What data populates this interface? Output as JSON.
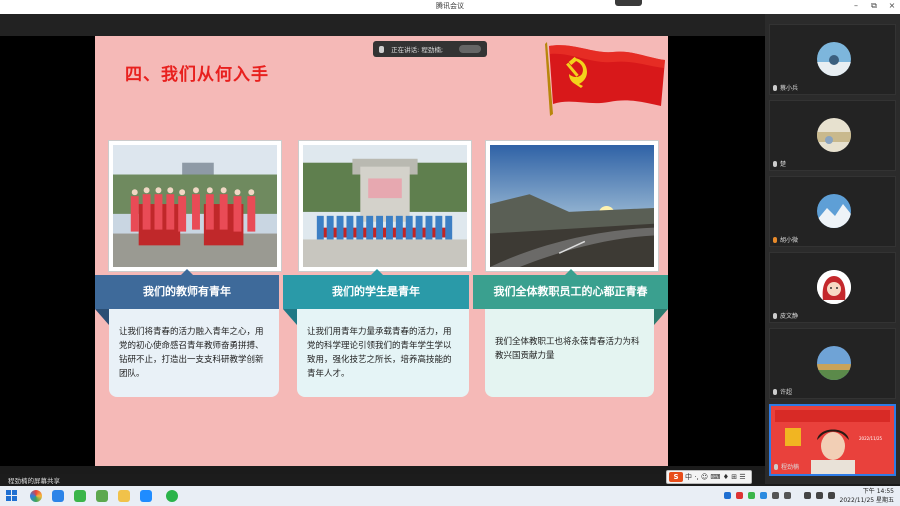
{
  "window": {
    "title": "腾讯会议",
    "minimize_glyph": "–",
    "maximize_glyph": "⧉",
    "close_glyph": "×"
  },
  "speaking": {
    "label": "正在讲话: 程劲楠;"
  },
  "slide": {
    "title": "四、我们从何入手",
    "cards": [
      {
        "heading": "我们的教师有青年",
        "body": "让我们将青春的活力融入青年之心，用党的初心使命感召青年教师奋勇拼搏、钻研不止，打造出一支支科研教学创新团队。",
        "head_color": "#3e6a9a",
        "body_color": "#e9f1f7"
      },
      {
        "heading": "我们的学生是青年",
        "body": "让我们用青年力量承载青春的活力，用党的科学理论引领我们的青年学生学以致用，强化技艺之所长，培养高技能的青年人才。",
        "head_color": "#2a9aa8",
        "body_color": "#e5f4f6"
      },
      {
        "heading": "我们全体教职员工的心都正青春",
        "body": "我们全体教职工也将永葆青春活力为科教兴国贡献力量",
        "head_color": "#3aa08f",
        "body_color": "#e4f4f1"
      }
    ]
  },
  "participants": [
    {
      "name": "蔡小兵",
      "avatar": "sky-photo"
    },
    {
      "name": "楚",
      "avatar": "ship-photo"
    },
    {
      "name": "胡小微",
      "avatar": "mountain-photo"
    },
    {
      "name": "皮文静",
      "avatar": "cartoon-girl"
    },
    {
      "name": "许超",
      "avatar": "field-photo"
    },
    {
      "name": "程劲楠",
      "avatar": "camera-feed",
      "video_caption": "2022/11/25"
    }
  ],
  "share_notice": "程劲楠的屏幕共享",
  "ime": {
    "logo": "S",
    "items": "中 ·, ☺ ⌨ ♦ ⊞ ☰"
  },
  "clock": {
    "time": "下午 14:55",
    "date": "2022/11/25 星期五"
  },
  "colors": {
    "slide_bg": "#f5b9b7",
    "title_red": "#e8201e",
    "flag_red": "#d8181a",
    "flag_gold": "#f3d21b",
    "active_border": "#2e7be6"
  }
}
